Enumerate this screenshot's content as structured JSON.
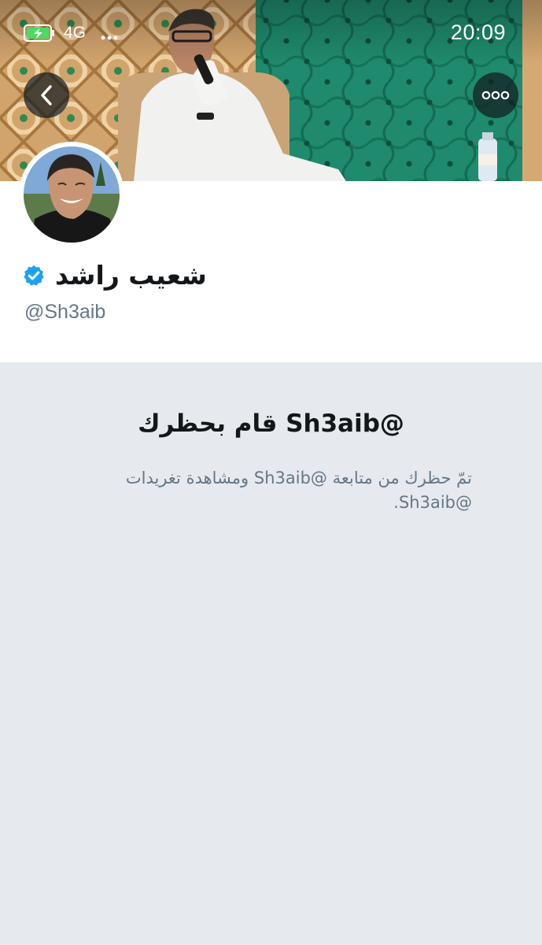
{
  "status_bar": {
    "network": "4G",
    "time": "20:09",
    "battery_icon": "battery-charging-icon",
    "battery_color": "#4cd964"
  },
  "navigation": {
    "back_icon": "chevron-left-icon",
    "more_icon": "more-options-icon"
  },
  "profile": {
    "display_name": "شعيب راشد",
    "verified": true,
    "handle": "@Sh3aib",
    "verified_color": "#1da1f2"
  },
  "blocked_notice": {
    "title": "@Sh3aib قام بحظرك",
    "body": "تمّ حظرك من متابعة @Sh3aib ومشاهدة تغريدات @Sh3aib."
  },
  "colors": {
    "background": "#e6e9ee",
    "text_primary": "#14171a",
    "text_secondary": "#657786"
  }
}
